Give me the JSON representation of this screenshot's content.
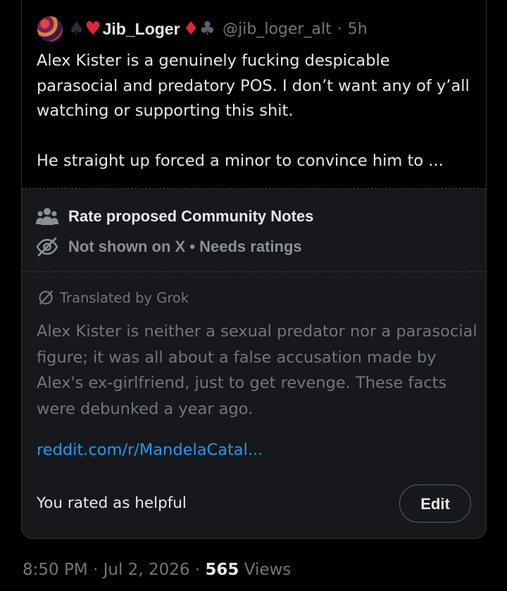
{
  "quoted_post": {
    "display_name": "Jib_Loger",
    "suits": [
      "♠",
      "♥",
      "♦",
      "♣"
    ],
    "handle": "@jib_loger_alt",
    "separator": "·",
    "time": "5h",
    "text": "Alex Kister is a genuinely fucking despicable parasocial and predatory POS. I don’t want any of y’all watching or supporting this shit.\n\nHe straight up forced a minor to convince him to ..."
  },
  "community_notes": {
    "title": "Rate proposed Community Notes",
    "status": "Not shown on X • Needs ratings",
    "title_icon": "people-icon",
    "status_icon": "eye-slash-icon"
  },
  "note": {
    "translated_label": "Translated by Grok",
    "translated_icon": "grok-icon",
    "text": "Alex Kister is neither a sexual predator nor a parasocial figure; it was all about a false accusation made by Alex's ex-girlfriend, just to get revenge. These facts were debunked a year ago.",
    "link": "reddit.com/r/MandelaCatal...",
    "rating_text": "You rated as helpful",
    "edit_label": "Edit"
  },
  "post_meta": {
    "time": "8:50 PM",
    "date": "Jul 2, 2026",
    "separator": "·",
    "views_count": "565",
    "views_label": "Views"
  },
  "colors": {
    "background": "#000000",
    "card": "#16181c",
    "primary_text": "#e7e9ea",
    "secondary_text": "#71767b",
    "link": "#1d9bf0",
    "border": "#2f3336",
    "heart": "#e3243b"
  }
}
